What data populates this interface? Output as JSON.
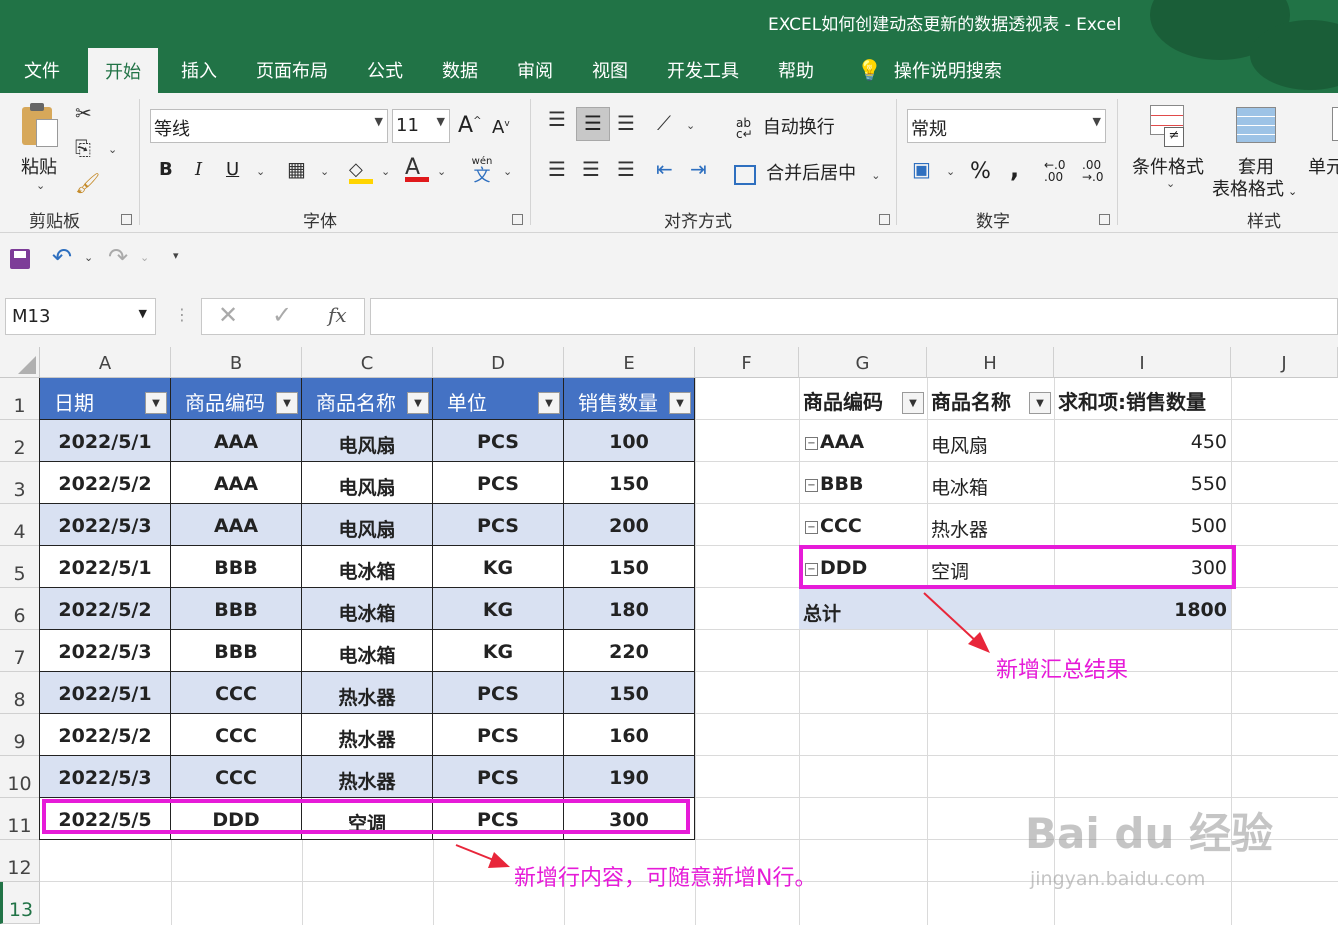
{
  "window": {
    "title": "EXCEL如何创建动态更新的数据透视表  -  Excel"
  },
  "tabs": [
    "文件",
    "开始",
    "插入",
    "页面布局",
    "公式",
    "数据",
    "审阅",
    "视图",
    "开发工具",
    "帮助"
  ],
  "active_tab": "开始",
  "tell_me": "操作说明搜索",
  "ribbon": {
    "clipboard": {
      "paste": "粘贴",
      "label": "剪贴板"
    },
    "font": {
      "name": "等线",
      "size": "11",
      "label": "字体",
      "bold": "B",
      "italic": "I",
      "underline": "U",
      "wen": "wén",
      "wen_char": "文"
    },
    "alignment": {
      "wrap": "自动换行",
      "merge": "合并后居中",
      "label": "对齐方式"
    },
    "number": {
      "format": "常规",
      "percent": "%",
      "comma": ",",
      "label": "数字",
      "inc": "←.0\n.00",
      "dec": ".00\n→.0"
    },
    "styles": {
      "conditional": "条件格式",
      "table_format_1": "套用",
      "table_format_2": "表格格式",
      "cell": "单元",
      "label": "样式"
    }
  },
  "formula_bar": {
    "name_box": "M13",
    "fx": "fx",
    "formula": ""
  },
  "columns": [
    "A",
    "B",
    "C",
    "D",
    "E",
    "F",
    "G",
    "H",
    "I",
    "J"
  ],
  "rows": [
    "1",
    "2",
    "3",
    "4",
    "5",
    "6",
    "7",
    "8",
    "9",
    "10",
    "11",
    "12",
    "13"
  ],
  "table": {
    "headers": [
      "日期",
      "商品编码",
      "商品名称",
      "单位",
      "销售数量"
    ],
    "rows": [
      [
        "2022/5/1",
        "AAA",
        "电风扇",
        "PCS",
        "100"
      ],
      [
        "2022/5/2",
        "AAA",
        "电风扇",
        "PCS",
        "150"
      ],
      [
        "2022/5/3",
        "AAA",
        "电风扇",
        "PCS",
        "200"
      ],
      [
        "2022/5/1",
        "BBB",
        "电冰箱",
        "KG",
        "150"
      ],
      [
        "2022/5/2",
        "BBB",
        "电冰箱",
        "KG",
        "180"
      ],
      [
        "2022/5/3",
        "BBB",
        "电冰箱",
        "KG",
        "220"
      ],
      [
        "2022/5/1",
        "CCC",
        "热水器",
        "PCS",
        "150"
      ],
      [
        "2022/5/2",
        "CCC",
        "热水器",
        "PCS",
        "160"
      ],
      [
        "2022/5/3",
        "CCC",
        "热水器",
        "PCS",
        "190"
      ],
      [
        "2022/5/5",
        "DDD",
        "空调",
        "PCS",
        "300"
      ]
    ]
  },
  "pivot": {
    "headers": [
      "商品编码",
      "商品名称",
      "求和项:销售数量"
    ],
    "rows": [
      [
        "AAA",
        "电风扇",
        "450"
      ],
      [
        "BBB",
        "电冰箱",
        "550"
      ],
      [
        "CCC",
        "热水器",
        "500"
      ],
      [
        "DDD",
        "空调",
        "300"
      ]
    ],
    "total_label": "总计",
    "total_value": "1800"
  },
  "annotations": {
    "pivot_note": "新增汇总结果",
    "table_note": "新增行内容，可随意新增N行。",
    "color": "#e61bd8"
  },
  "watermark": {
    "logo": "Bai du 经验",
    "url": "jingyan.baidu.com"
  },
  "colors": {
    "excel_green": "#217346",
    "table_header": "#4472c4",
    "band": "#d9e1f2"
  }
}
